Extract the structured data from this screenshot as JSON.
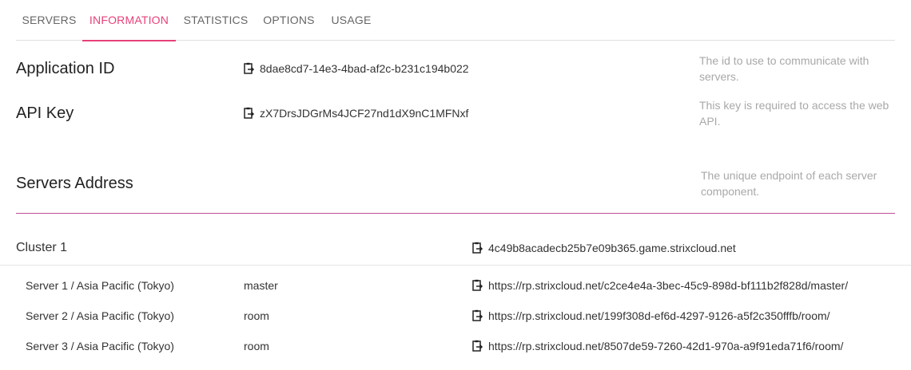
{
  "tabs": [
    {
      "label": "SERVERS",
      "active": false
    },
    {
      "label": "INFORMATION",
      "active": true
    },
    {
      "label": "STATISTICS",
      "active": false
    },
    {
      "label": "OPTIONS",
      "active": false
    },
    {
      "label": "USAGE",
      "active": false
    }
  ],
  "info": {
    "app_id": {
      "label": "Application ID",
      "value": "8dae8cd7-14e3-4bad-af2c-b231c194b022",
      "description": "The id to use to communicate with servers."
    },
    "api_key": {
      "label": "API Key",
      "value": "zX7DrsJDGrMs4JCF27nd1dX9nC1MFNxf",
      "description": "This key is required to access the web API."
    },
    "servers_address": {
      "label": "Servers Address",
      "description": "The unique endpoint of each server component."
    }
  },
  "cluster": {
    "label": "Cluster 1",
    "address": "4c49b8acadecb25b7e09b365.game.strixcloud.net",
    "servers": [
      {
        "name": "Server 1 / Asia Pacific (Tokyo)",
        "role": "master",
        "url": "https://rp.strixcloud.net/c2ce4e4a-3bec-45c9-898d-bf111b2f828d/master/"
      },
      {
        "name": "Server 2 / Asia Pacific (Tokyo)",
        "role": "room",
        "url": "https://rp.strixcloud.net/199f308d-ef6d-4297-9126-a5f2c350fffb/room/"
      },
      {
        "name": "Server 3 / Asia Pacific (Tokyo)",
        "role": "room",
        "url": "https://rp.strixcloud.net/8507de59-7260-42d1-970a-a9f91eda71f6/room/"
      }
    ]
  },
  "colors": {
    "accent": "#e8407a",
    "divider": "#c0509a"
  },
  "icons": {
    "copy": "clipboard-copy-icon"
  }
}
